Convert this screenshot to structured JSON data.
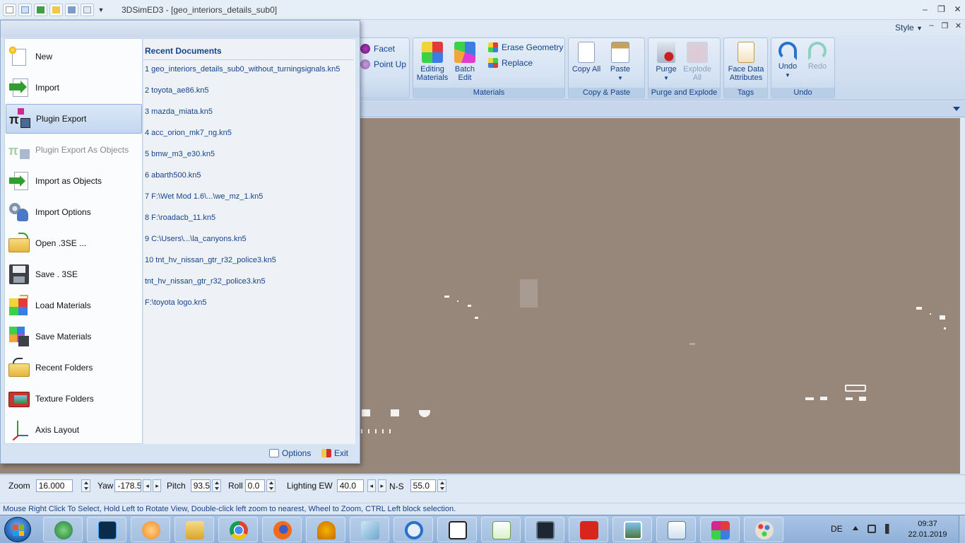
{
  "window": {
    "title": "3DSimED3 - [geo_interiors_details_sub0]",
    "controls": [
      "‒",
      "❐",
      "✕"
    ]
  },
  "ribbon": {
    "style_menu": "Style",
    "mdi_controls": [
      "‒",
      "❐",
      "✕"
    ],
    "geometry_partial": {
      "facet": "Facet",
      "point_up": "Point Up"
    },
    "materials": {
      "editing_materials": "Editing Materials",
      "batch_edit": "Batch Edit",
      "erase_geometry": "Erase Geometry",
      "replace": "Replace",
      "label": "Materials"
    },
    "copy_paste": {
      "copy_all": "Copy All",
      "paste": "Paste",
      "label": "Copy & Paste"
    },
    "purge_explode": {
      "purge": "Purge",
      "explode_all": "Explode All",
      "label": "Purge and Explode"
    },
    "tags": {
      "face_data_attributes": "Face Data Attributes",
      "label": "Tags"
    },
    "undo": {
      "undo": "Undo",
      "redo": "Redo",
      "label": "Undo"
    }
  },
  "app_menu": {
    "items": [
      {
        "label": "New",
        "icon": "new-document-icon"
      },
      {
        "label": "Import",
        "icon": "import-arrow-icon"
      },
      {
        "label": "Plugin Export",
        "icon": "plugin-export-icon"
      },
      {
        "label": "Plugin Export As Objects",
        "icon": "plugin-export-objects-icon"
      },
      {
        "label": "Import as Objects",
        "icon": "import-objects-icon"
      },
      {
        "label": "Import Options",
        "icon": "import-options-icon"
      },
      {
        "label": "Open .3SE ...",
        "icon": "open-folder-icon"
      },
      {
        "label": "Save . 3SE",
        "icon": "save-disk-icon"
      },
      {
        "label": "Load Materials",
        "icon": "load-materials-icon"
      },
      {
        "label": "Save Materials",
        "icon": "save-materials-icon"
      },
      {
        "label": "Recent Folders",
        "icon": "recent-folders-icon"
      },
      {
        "label": "Texture Folders",
        "icon": "texture-folders-icon"
      },
      {
        "label": "Axis Layout",
        "icon": "axis-layout-icon"
      }
    ],
    "recent_title": "Recent Documents",
    "recent": [
      "1 geo_interiors_details_sub0_without_turningsignals.kn5",
      "2 toyota_ae86.kn5",
      "3 mazda_miata.kn5",
      "4 acc_orion_mk7_ng.kn5",
      "5 bmw_m3_e30.kn5",
      "6 abarth500.kn5",
      "7 F:\\Wet Mod 1.6\\...\\we_mz_1.kn5",
      "8 F:\\roadacb_11.kn5",
      "9 C:\\Users\\...\\la_canyons.kn5",
      "10 tnt_hv_nissan_gtr_r32_police3.kn5",
      "tnt_hv_nissan_gtr_r32_police3.kn5",
      "F:\\toyota logo.kn5"
    ],
    "options_label": "Options",
    "exit_label": "Exit"
  },
  "toolbar": {
    "zoom_label": "Zoom",
    "zoom_value": "16.000",
    "yaw_label": "Yaw",
    "yaw_value": "-178.5",
    "pitch_label": "Pitch",
    "pitch_value": "93.5",
    "roll_label": "Roll",
    "roll_value": "0.0",
    "lighting_label": "Lighting EW",
    "lighting_value": "40.0",
    "ns_label": "N-S",
    "ns_value": "55.0"
  },
  "status": "Mouse Right Click To Select, Hold Left to Rotate View, Double-click left  zoom to nearest, Wheel to Zoom, CTRL Left block selection.",
  "taskbar": {
    "apps": [
      "globe-app-icon",
      "photoshop-icon",
      "media-player-icon",
      "file-explorer-icon",
      "chrome-icon",
      "firefox-icon",
      "audio-app-icon",
      "notepad-icon",
      "sync-icon",
      "unity-icon",
      "notepad-plus-icon",
      "monitor-app-icon",
      "acrobat-icon",
      "photo-viewer-icon",
      "wordpad-icon",
      "3dsimed-icon",
      "paint-icon"
    ],
    "language": "DE",
    "time": "09:37",
    "date": "22.01.2019"
  },
  "colors": {
    "viewport": "#97877a",
    "ribbon_text": "#15428b",
    "menu_bg": "#d6e3f2"
  }
}
